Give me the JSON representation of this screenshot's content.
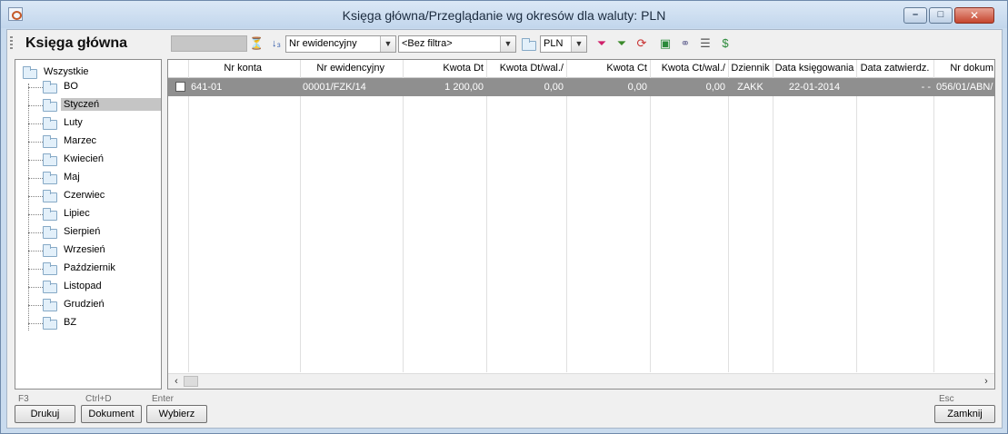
{
  "window": {
    "title": "Księga główna/Przeglądanie wg okresów dla waluty: PLN"
  },
  "toolbar": {
    "app_title": "Księga główna",
    "sort_field": "Nr ewidencyjny",
    "filter": "<Bez filtra>",
    "currency": "PLN"
  },
  "tree": {
    "root": "Wszystkie",
    "items": [
      "BO",
      "Styczeń",
      "Luty",
      "Marzec",
      "Kwiecień",
      "Maj",
      "Czerwiec",
      "Lipiec",
      "Sierpień",
      "Wrzesień",
      "Październik",
      "Listopad",
      "Grudzień",
      "BZ"
    ],
    "selected": "Styczeń"
  },
  "grid": {
    "columns": [
      "Nr konta",
      "Nr ewidencyjny",
      "Kwota Dt",
      "Kwota Dt/wal./",
      "Kwota Ct",
      "Kwota Ct/wal./",
      "Dziennik",
      "Data księgowania",
      "Data zatwierdz.",
      "Nr dokum"
    ],
    "rows": [
      [
        "641-01",
        "00001/FZK/14",
        "1 200,00",
        "0,00",
        "0,00",
        "0,00",
        "ZAKK",
        "22-01-2014",
        "- -",
        "056/01/ABN/"
      ]
    ]
  },
  "footer": {
    "buttons": [
      {
        "hotkey": "F3",
        "label": "Drukuj"
      },
      {
        "hotkey": "Ctrl+D",
        "label": "Dokument"
      },
      {
        "hotkey": "Enter",
        "label": "Wybierz"
      }
    ],
    "close": {
      "hotkey": "Esc",
      "label": "Zamknij"
    }
  }
}
